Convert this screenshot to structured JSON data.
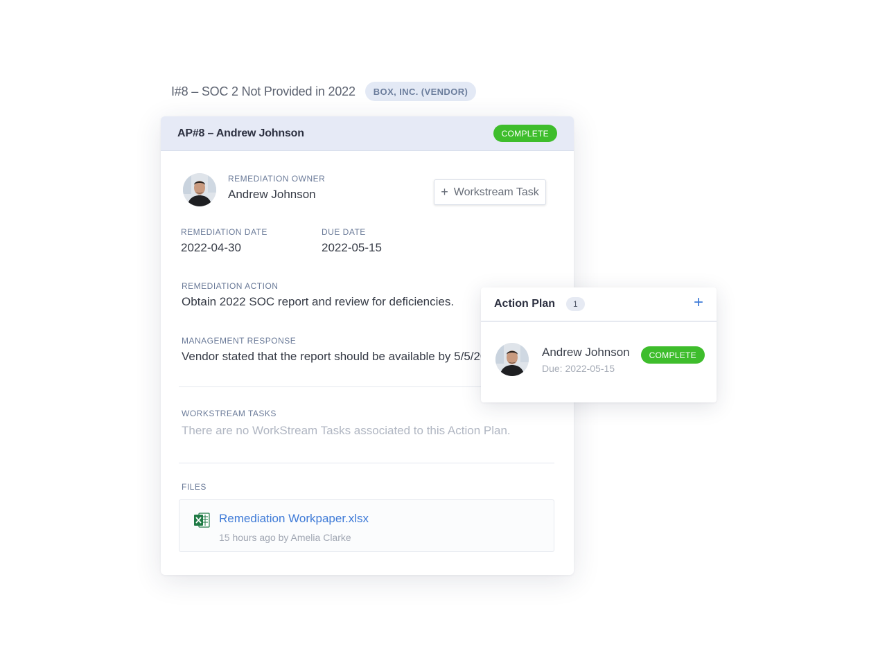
{
  "issue": {
    "title": "I#8 – SOC 2 Not Provided in 2022",
    "vendor_badge": "BOX, INC. (VENDOR)"
  },
  "card": {
    "title": "AP#8 – Andrew Johnson",
    "status": "COMPLETE",
    "owner_label": "REMEDIATION OWNER",
    "owner_name": "Andrew Johnson",
    "workstream_button": "Workstream Task",
    "remediation_date_label": "REMEDIATION DATE",
    "remediation_date": "2022-04-30",
    "due_date_label": "DUE DATE",
    "due_date": "2022-05-15",
    "action_label": "REMEDIATION ACTION",
    "action_text": "Obtain 2022 SOC report and review for deficiencies.",
    "response_label": "MANAGEMENT RESPONSE",
    "response_text": "Vendor stated that the report should be available by 5/5/2022.",
    "tasks_label": "WORKSTREAM TASKS",
    "tasks_empty": "There are no WorkStream Tasks associated to this Action Plan.",
    "files_label": "FILES",
    "file": {
      "name": "Remediation Workpaper.xlsx",
      "meta": "15 hours ago by Amelia Clarke",
      "icon": "excel-file-icon"
    }
  },
  "action_plan": {
    "title": "Action Plan",
    "count": "1",
    "add_icon": "plus-icon",
    "items": [
      {
        "name": "Andrew Johnson",
        "due": "Due: 2022-05-15",
        "status": "COMPLETE"
      }
    ]
  },
  "colors": {
    "complete": "#3ebd2c",
    "accent": "#3e7ad7",
    "header_bg": "#e6eaf6"
  }
}
